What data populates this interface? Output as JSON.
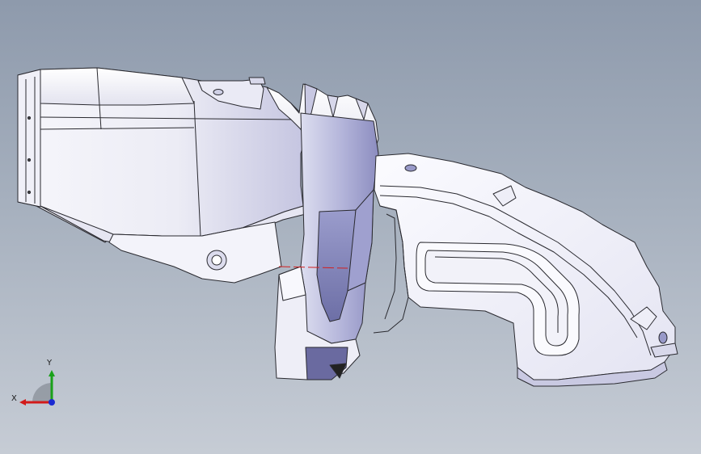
{
  "viewport": {
    "background_top": "#8e9aac",
    "background_bottom": "#c6ccd5",
    "model_fill": "#f4f4fa",
    "model_shadow": "#8a8ab8",
    "edge_color": "#2a2a30",
    "section_line_color": "#d22020"
  },
  "triad": {
    "x_label": "X",
    "y_label": "Y",
    "x_color": "#d21a1a",
    "y_color": "#1aa11a",
    "z_color": "#1a2ad2"
  }
}
